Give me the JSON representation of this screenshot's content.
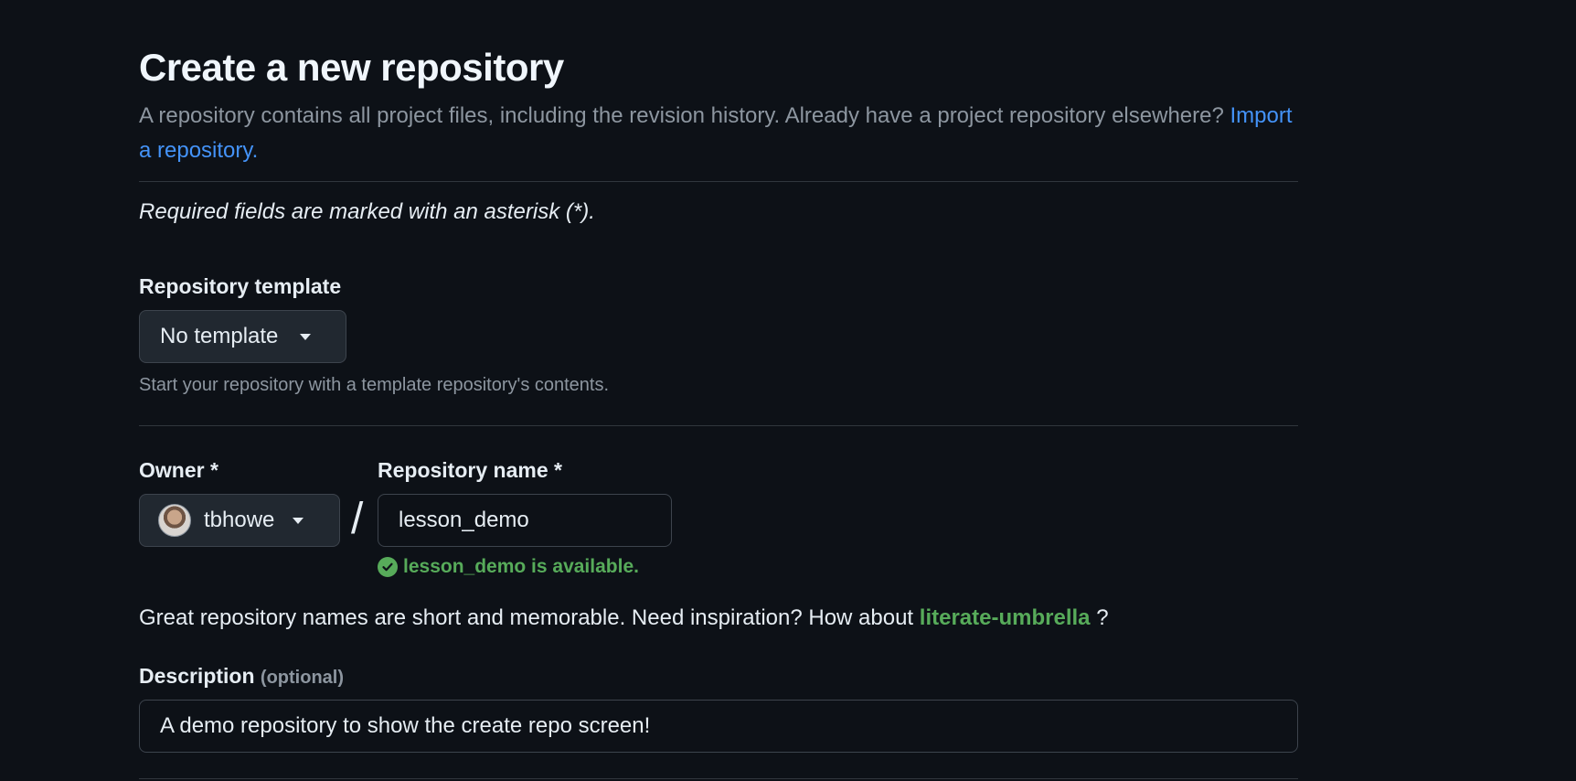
{
  "header": {
    "title": "Create a new repository",
    "subtitle": "A repository contains all project files, including the revision history. Already have a project repository elsewhere?",
    "import_link": "Import a repository."
  },
  "required_note": "Required fields are marked with an asterisk (*).",
  "template": {
    "label": "Repository template",
    "selected": "No template",
    "hint": "Start your repository with a template repository's contents."
  },
  "owner": {
    "label": "Owner *",
    "value": "tbhowe"
  },
  "separator": "/",
  "repo_name": {
    "label": "Repository name *",
    "value": "lesson_demo",
    "availability": "lesson_demo is available."
  },
  "suggestion": {
    "text_before": "Great repository names are short and memorable. Need inspiration? How about",
    "name": "literate-umbrella",
    "text_after": "?"
  },
  "description": {
    "label": "Description",
    "optional": "(optional)",
    "value": "A demo repository to show the create repo screen!"
  },
  "colors": {
    "background": "#0d1117",
    "link": "#4493f8",
    "success": "#57ab5a",
    "muted": "#8d96a0"
  }
}
